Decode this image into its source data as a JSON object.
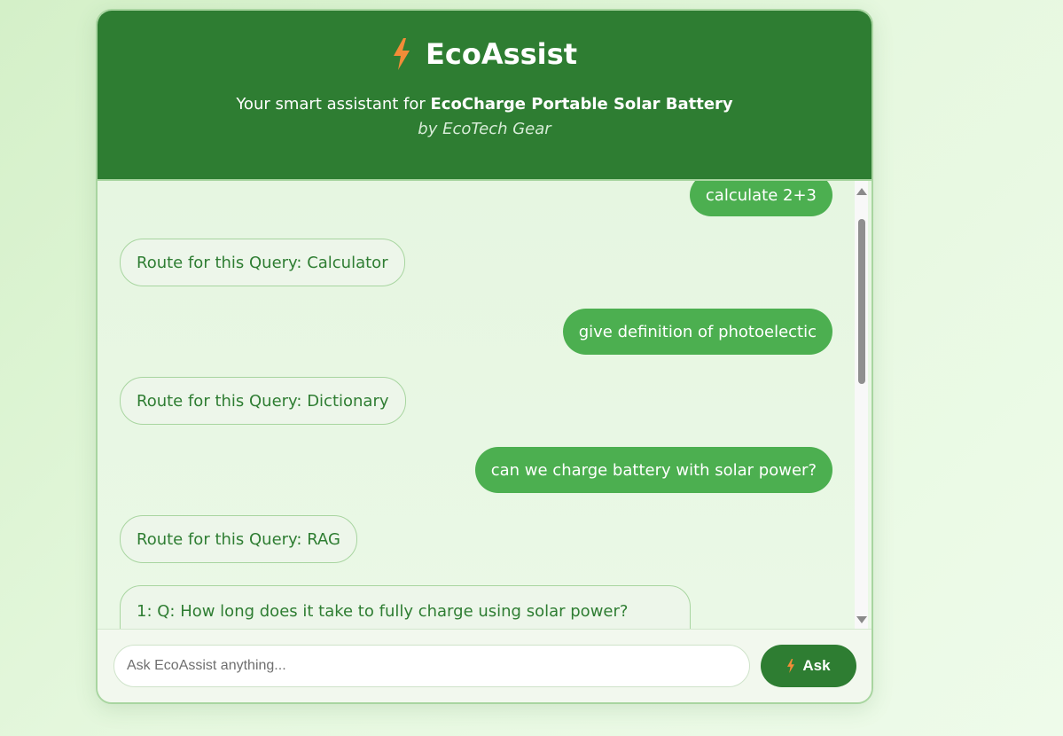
{
  "header": {
    "title": "EcoAssist",
    "subtitle_prefix": "Your smart assistant for ",
    "product_name": "EcoCharge Portable Solar Battery",
    "byline": "by EcoTech Gear",
    "icon": "lightning-bolt-icon",
    "background_color": "#2e7d32",
    "icon_color": "#f28c38"
  },
  "messages": [
    {
      "role": "user",
      "text": "calculate 2+3"
    },
    {
      "role": "bot",
      "text": "Route for this Query: Calculator"
    },
    {
      "role": "user",
      "text": "give definition of photoelectic"
    },
    {
      "role": "bot",
      "text": "Route for this Query: Dictionary"
    },
    {
      "role": "user",
      "text": "can we charge battery with solar power?"
    },
    {
      "role": "bot",
      "text": "Route for this Query: RAG"
    },
    {
      "role": "bot",
      "text": "1: Q: How long does it take to fully charge using solar power?"
    }
  ],
  "input": {
    "placeholder": "Ask EcoAssist anything...",
    "value": ""
  },
  "ask_button": {
    "label": "Ask",
    "icon": "lightning-bolt-icon"
  },
  "colors": {
    "user_bubble": "#4caf50",
    "bot_bubble": "#edf6ea",
    "bot_text": "#2e7d32"
  }
}
